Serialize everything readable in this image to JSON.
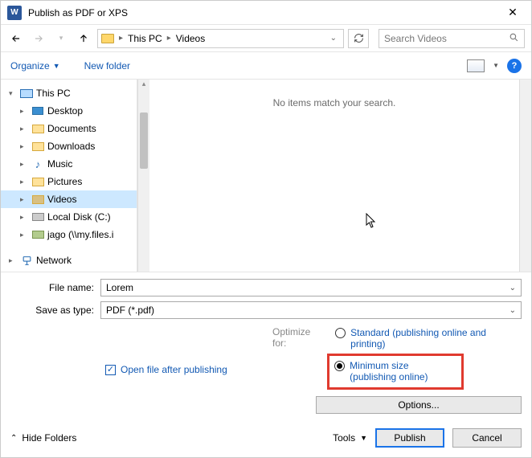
{
  "title": "Publish as PDF or XPS",
  "breadcrumb": {
    "root": "This PC",
    "current": "Videos"
  },
  "search": {
    "placeholder": "Search Videos"
  },
  "toolbar": {
    "organize": "Organize",
    "new_folder": "New folder"
  },
  "tree": {
    "root": "This PC",
    "items": [
      {
        "label": "Desktop"
      },
      {
        "label": "Documents"
      },
      {
        "label": "Downloads"
      },
      {
        "label": "Music"
      },
      {
        "label": "Pictures"
      },
      {
        "label": "Videos"
      },
      {
        "label": "Local Disk (C:)"
      },
      {
        "label": "jago (\\\\my.files.i"
      }
    ],
    "network": "Network"
  },
  "content": {
    "empty_msg": "No items match your search."
  },
  "form": {
    "filename_label": "File name:",
    "filename_value": "Lorem",
    "savetype_label": "Save as type:",
    "savetype_value": "PDF (*.pdf)",
    "open_after": "Open file after publishing",
    "optimize_label": "Optimize for:",
    "opt_standard": "Standard (publishing online and printing)",
    "opt_min": "Minimum size (publishing online)",
    "options_btn": "Options..."
  },
  "footer": {
    "hide_folders": "Hide Folders",
    "tools": "Tools",
    "publish": "Publish",
    "cancel": "Cancel"
  }
}
